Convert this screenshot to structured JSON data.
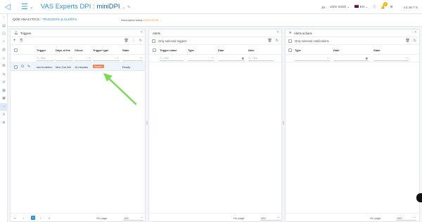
{
  "header": {
    "app_title": "VAS Experts DPI",
    "instance": "miniDPI",
    "user_initials": "JS",
    "user_name": "John Smith",
    "language": "EN",
    "notification_count": "3",
    "version": "v.2.16.7 S"
  },
  "breadcrumb": {
    "root": "QOE ANALYTICS",
    "current": "TRIGGERS & ALERTS"
  },
  "subscription": {
    "label": "Subscription status",
    "value": "DEMO MODE"
  },
  "triggers_panel": {
    "title": "Triggers",
    "columns": [
      "Trigger",
      "Days of the",
      "Check",
      "Trigger type",
      "State"
    ],
    "filter_placeholder": "Filter",
    "rows": [
      {
        "trigger": "ssh bruteforc",
        "days": "Mon,Tue,We",
        "check": "10 minutes",
        "type": "System",
        "state": "Ready"
      }
    ],
    "pager": {
      "page": "1",
      "on_page_label": "On page",
      "per_page": "100"
    }
  },
  "alerts_panel": {
    "title": "Alerts",
    "only_selected_label": "Only selected triggers",
    "columns": [
      "Trigger name",
      "Type",
      "Date",
      "Note"
    ],
    "filter_placeholder": "Filter",
    "pager": {
      "on_page_label": "On page",
      "per_page": "100"
    }
  },
  "actions_panel": {
    "title": "Alerts actions",
    "only_selected_label": "Only selected notifications",
    "columns": [
      "Type",
      "Date",
      "State"
    ],
    "pager": {
      "on_page_label": "On page",
      "per_page": "100"
    }
  },
  "colors": {
    "accent": "#2f8fd8",
    "system_tag": "#f08050",
    "annotation_arrow": "#7ed957",
    "badge": "#f4b400"
  }
}
